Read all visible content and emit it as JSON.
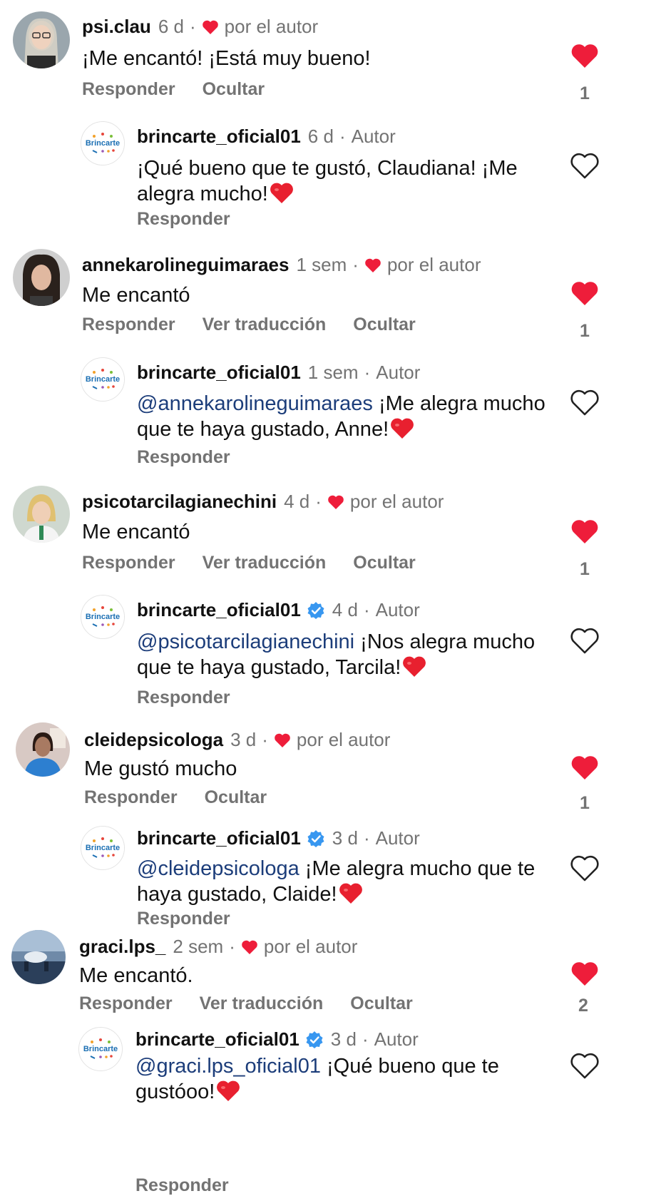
{
  "colors": {
    "heart_red": "#ee1d3a",
    "muted": "#737373",
    "mention": "#1c3d7a",
    "verified": "#3897f0"
  },
  "labels": {
    "reply": "Responder",
    "hide": "Ocultar",
    "translate": "Ver traducción",
    "by_author": "por el autor",
    "author": "Autor",
    "dot": "·"
  },
  "threads": [
    {
      "comment": {
        "username": "psi.clau",
        "time": "6 d",
        "text": "¡Me encantó! ¡Está muy bueno!",
        "likes": "1",
        "liked": true,
        "actions": [
          "Responder",
          "Ocultar"
        ]
      },
      "reply": {
        "username": "brincarte_oficial01",
        "time": "6 d",
        "verified": false,
        "mention": "",
        "text": "¡Qué bueno que te gustó, Claudiana! ¡Me alegra mucho!",
        "emoji": "red-heart"
      }
    },
    {
      "comment": {
        "username": "annekarolineguimaraes",
        "time": "1 sem",
        "text": "Me encantó",
        "likes": "1",
        "liked": true,
        "actions": [
          "Responder",
          "Ver traducción",
          "Ocultar"
        ]
      },
      "reply": {
        "username": "brincarte_oficial01",
        "time": "1 sem",
        "verified": false,
        "mention": "@annekarolineguimaraes",
        "text": " ¡Me alegra mucho que te haya gustado, Anne!",
        "emoji": "red-heart"
      }
    },
    {
      "comment": {
        "username": "psicotarcilagianechini",
        "time": "4 d",
        "text": "Me encantó",
        "likes": "1",
        "liked": true,
        "actions": [
          "Responder",
          "Ver traducción",
          "Ocultar"
        ]
      },
      "reply": {
        "username": "brincarte_oficial01",
        "time": "4 d",
        "verified": true,
        "mention": "@psicotarcilagianechini",
        "text": " ¡Nos alegra mucho que te haya gustado, Tarcila!",
        "emoji": "red-heart"
      }
    },
    {
      "comment": {
        "username": "cleidepsicologa",
        "time": "3 d",
        "text": "Me gustó mucho",
        "likes": "1",
        "liked": true,
        "actions": [
          "Responder",
          "Ocultar"
        ]
      },
      "reply": {
        "username": "brincarte_oficial01",
        "time": "3 d",
        "verified": true,
        "mention": "@cleidepsicologa",
        "text": " ¡Me alegra mucho que te haya gustado, Claide!",
        "emoji": "red-heart"
      }
    },
    {
      "comment": {
        "username": "graci.lps_",
        "time": "2 sem",
        "text": "Me encantó.",
        "likes": "2",
        "liked": true,
        "actions": [
          "Responder",
          "Ver traducción",
          "Ocultar"
        ]
      },
      "reply": {
        "username": "brincarte_oficial01",
        "time": "3 d",
        "verified": true,
        "mention": "@graci.lps_oficial01",
        "text": " ¡Qué bueno que te gustóoo!",
        "emoji": "red-heart"
      }
    }
  ],
  "brand_logo_text": "Brincarte"
}
